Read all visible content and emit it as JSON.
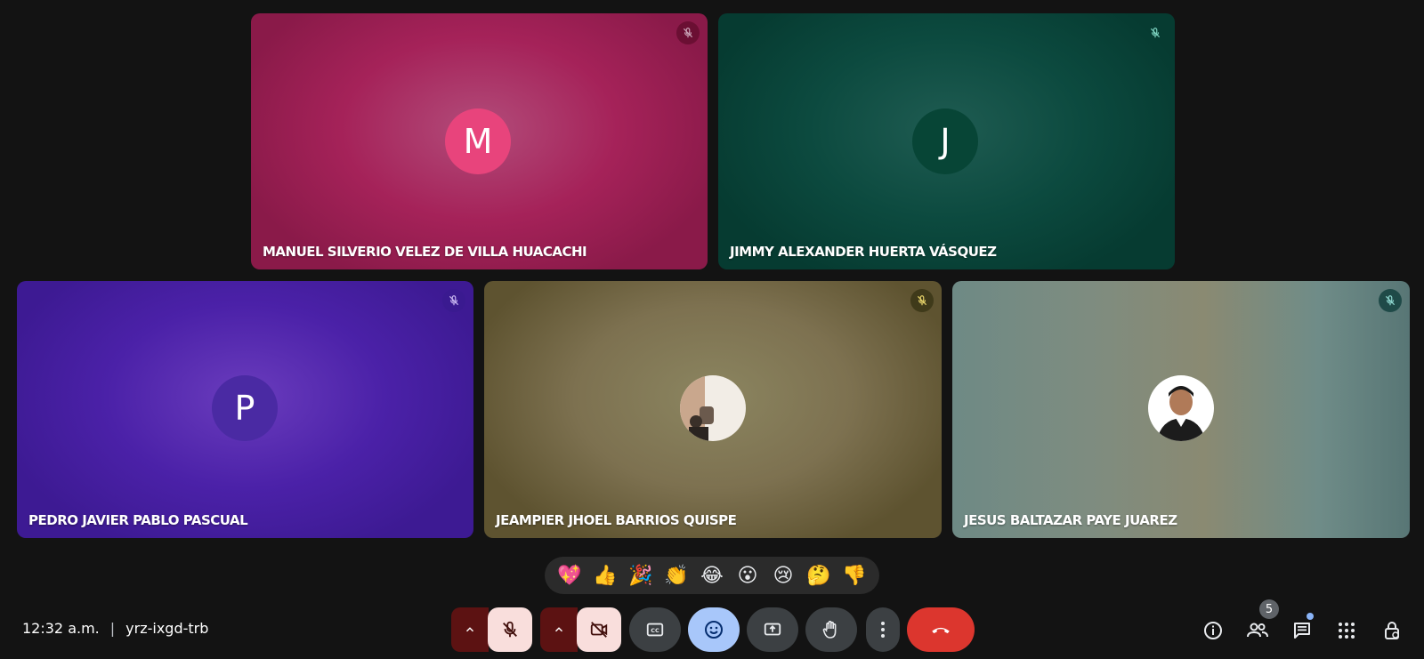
{
  "participants": [
    {
      "name": "MANUEL SILVERIO VELEZ DE VILLA HUACACHI",
      "initial": "M",
      "muted": true
    },
    {
      "name": "JIMMY ALEXANDER HUERTA VÁSQUEZ",
      "initial": "J",
      "muted": true
    },
    {
      "name": "PEDRO JAVIER PABLO PASCUAL",
      "initial": "P",
      "muted": true
    },
    {
      "name": "JEAMPIER JHOEL BARRIOS QUISPE",
      "avatar": "photo",
      "muted": true
    },
    {
      "name": "JESUS BALTAZAR PAYE JUAREZ",
      "avatar": "photo",
      "muted": true
    }
  ],
  "reactions": [
    "💖",
    "👍",
    "🎉",
    "👏",
    "😂",
    "😮",
    "😢",
    "🤔",
    "👎"
  ],
  "meeting": {
    "time": "12:32 a.m.",
    "separator": "|",
    "code": "yrz-ixgd-trb"
  },
  "controls": {
    "icons": [
      "chevron-up-icon",
      "mic-off-icon",
      "chevron-up-icon",
      "camera-off-icon",
      "captions-icon",
      "emoji-icon",
      "present-screen-icon",
      "raise-hand-icon",
      "more-options-icon",
      "end-call-icon"
    ]
  },
  "right_panel": {
    "people_count": "5",
    "icons": [
      "info-icon",
      "people-icon",
      "chat-icon",
      "activities-icon",
      "host-controls-icon"
    ]
  },
  "colors": {
    "background": "#131313",
    "end_call": "#dc362e",
    "reaction_active": "#a8c7fa",
    "muted_control": "#f9dedc"
  }
}
